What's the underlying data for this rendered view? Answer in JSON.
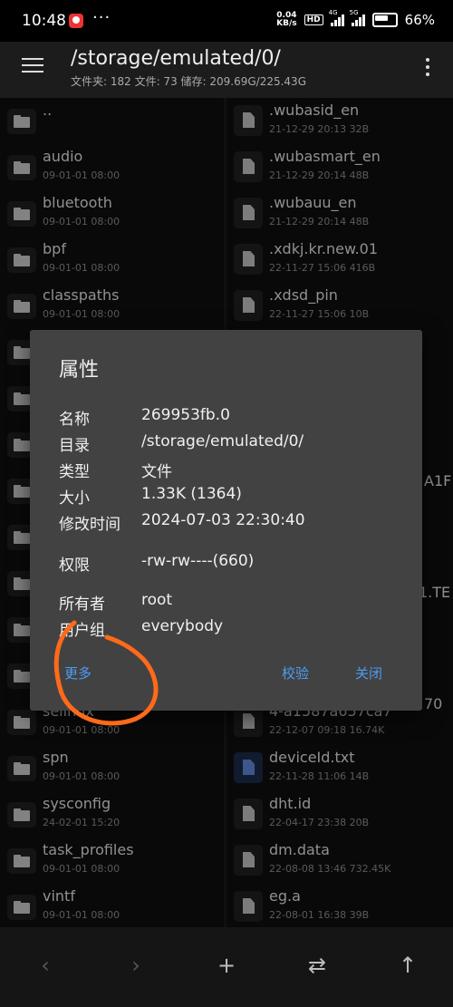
{
  "status_bar": {
    "time": "10:48",
    "dots": "···",
    "net_speed_value": "0.04",
    "net_speed_unit": "KB/s",
    "hd_label": "HD",
    "sig1_label": "4G",
    "sig2_label": "5G",
    "battery": "66%"
  },
  "toolbar": {
    "path": "/storage/emulated/0/",
    "stats": "文件夹: 182  文件: 73  储存: 209.69G/225.43G"
  },
  "left_list": [
    {
      "name": "..",
      "date": ""
    },
    {
      "name": "audio",
      "date": "09-01-01 08:00"
    },
    {
      "name": "bluetooth",
      "date": "09-01-01 08:00"
    },
    {
      "name": "bpf",
      "date": "09-01-01 08:00"
    },
    {
      "name": "classpaths",
      "date": "09-01-01 08:00"
    },
    {
      "name": "",
      "date": ""
    },
    {
      "name": "",
      "date": ""
    },
    {
      "name": "",
      "date": ""
    },
    {
      "name": "",
      "date": ""
    },
    {
      "name": "",
      "date": ""
    },
    {
      "name": "",
      "date": ""
    },
    {
      "name": "",
      "date": ""
    },
    {
      "name": "",
      "date": ""
    },
    {
      "name": "selinux",
      "date": "09-01-01 08:00"
    },
    {
      "name": "spn",
      "date": "09-01-01 08:00"
    },
    {
      "name": "sysconfig",
      "date": "24-02-01 15:20"
    },
    {
      "name": "task_profiles",
      "date": "09-01-01 08:00"
    },
    {
      "name": "vintf",
      "date": "09-01-01 08:00"
    }
  ],
  "right_list": [
    {
      "name": ".wubasid_en",
      "meta": "21-12-29 20:13  32B",
      "doc": false
    },
    {
      "name": ".wubasmart_en",
      "meta": "21-12-29 20:14  48B",
      "doc": false
    },
    {
      "name": ".wubauu_en",
      "meta": "21-12-29 20:14  48B",
      "doc": false
    },
    {
      "name": ".xdkj.kr.new.01",
      "meta": "22-11-27 15:06  416B",
      "doc": false
    },
    {
      "name": ".xdsd_pin",
      "meta": "22-11-27 15:06  10B",
      "doc": false
    },
    {
      "name": "",
      "meta": "",
      "doc": false
    },
    {
      "name": "",
      "meta": "",
      "doc": false
    },
    {
      "name": "",
      "meta": "",
      "doc": false
    },
    {
      "name": "",
      "meta": "",
      "doc": false
    },
    {
      "name": "",
      "meta": "",
      "doc": false
    },
    {
      "name": "",
      "meta": "",
      "doc": false
    },
    {
      "name": "",
      "meta": "",
      "doc": false
    },
    {
      "name": "",
      "meta": "",
      "doc": false
    },
    {
      "name": "4-a1587a657ca7",
      "meta": "22-12-07 09:18  16.74K",
      "doc": false
    },
    {
      "name": "deviceId.txt",
      "meta": "22-11-28 11:06  14B",
      "doc": true
    },
    {
      "name": "dht.id",
      "meta": "22-04-17 23:38  20B",
      "doc": false
    },
    {
      "name": "dm.data",
      "meta": "22-08-08 13:46  732.45K",
      "doc": false
    },
    {
      "name": "eg.a",
      "meta": "22-08-01 16:38  39B",
      "doc": false
    }
  ],
  "peek": {
    "a1f": "A1F",
    "te": "1.TE",
    "n70": "70"
  },
  "dialog": {
    "title": "属性",
    "props": [
      {
        "label": "名称",
        "value": "269953fb.0"
      },
      {
        "label": "目录",
        "value": "/storage/emulated/0/"
      },
      {
        "label": "类型",
        "value": "文件"
      },
      {
        "label": "大小",
        "value": "1.33K (1364)"
      },
      {
        "label": "修改时间",
        "value": "2024-07-03 22:30:40"
      },
      {
        "label": "权限",
        "value": "-rw-rw----(660)"
      },
      {
        "label": "所有者",
        "value": "root"
      },
      {
        "label": "用户组",
        "value": "everybody"
      }
    ],
    "btn_more": "更多",
    "btn_verify": "校验",
    "btn_close": "关闭"
  },
  "bottom_bar": {
    "back": "‹",
    "forward": "›",
    "add": "+",
    "swap": "⇄",
    "up": "↑"
  },
  "colors": {
    "accent": "#4d9cf4",
    "annotation": "#ff6a1a",
    "dialog_bg": "#424242"
  }
}
